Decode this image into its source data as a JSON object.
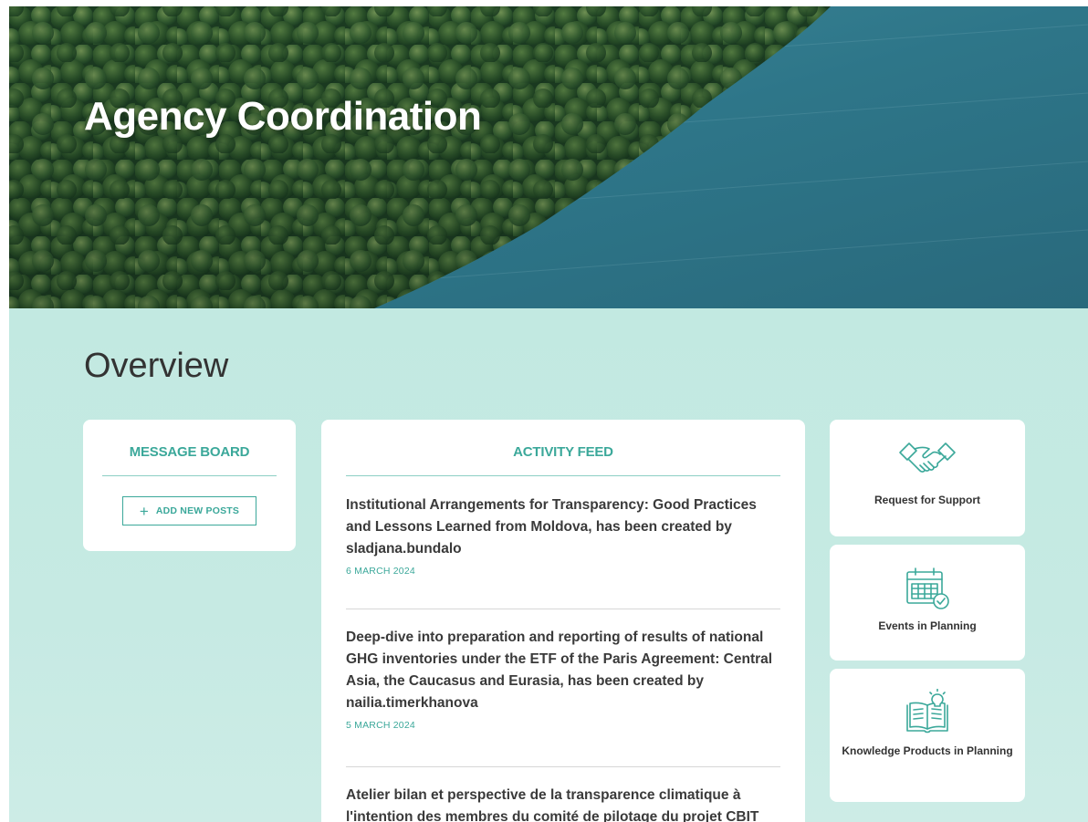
{
  "hero": {
    "title": "Agency Coordination"
  },
  "overview": {
    "heading": "Overview"
  },
  "message_board": {
    "heading": "MESSAGE BOARD",
    "add_button_icon": "plus-icon",
    "add_button_label": "ADD NEW POSTS"
  },
  "activity_feed": {
    "heading": "ACTIVITY FEED",
    "items": [
      {
        "title": "Institutional Arrangements for Transparency: Good Practices and Lessons Learned from Moldova, has been created by sladjana.bundalo",
        "date": "6 MARCH 2024"
      },
      {
        "title": "Deep-dive into preparation and reporting of results of national GHG inventories under the ETF of the Paris Agreement: Central Asia, the Caucasus and Eurasia, has been created by nailia.timerkhanova",
        "date": "5 MARCH 2024"
      },
      {
        "title": "Atelier bilan et perspective de la transparence climatique à l'intention des membres du comité de pilotage du projet CBIT",
        "date": ""
      }
    ]
  },
  "tiles": [
    {
      "label": "Request for Support",
      "icon": "handshake-icon"
    },
    {
      "label": "Events in Planning",
      "icon": "calendar-check-icon"
    },
    {
      "label": "Knowledge Products in Planning",
      "icon": "book-lightbulb-icon"
    }
  ],
  "colors": {
    "accent": "#3ba89a",
    "background": "#c4e9e2",
    "card": "#ffffff"
  }
}
